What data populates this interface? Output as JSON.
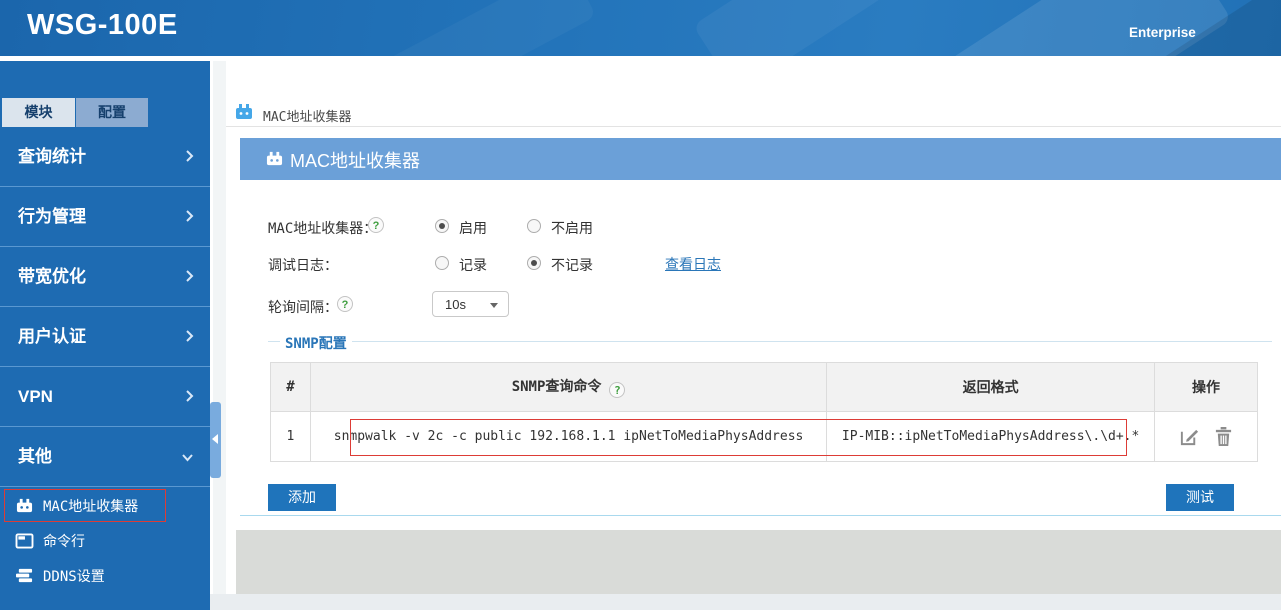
{
  "header": {
    "brand": "WSG-100E",
    "edition_label": "Enterprise"
  },
  "sidebar": {
    "tabs": [
      {
        "label": "模块",
        "active": true
      },
      {
        "label": "配置",
        "active": false
      }
    ],
    "items": [
      {
        "label": "查询统计"
      },
      {
        "label": "行为管理"
      },
      {
        "label": "带宽优化"
      },
      {
        "label": "用户认证"
      },
      {
        "label": "VPN"
      },
      {
        "label": "其他"
      }
    ],
    "subitems": [
      {
        "label": "MAC地址收集器",
        "icon": "collector-icon",
        "highlighted": true
      },
      {
        "label": "命令行",
        "icon": "terminal-icon",
        "highlighted": false
      },
      {
        "label": "DDNS设置",
        "icon": "server-icon",
        "highlighted": false
      }
    ]
  },
  "breadcrumb": {
    "label": "MAC地址收集器"
  },
  "panel": {
    "title": "MAC地址收集器"
  },
  "form": {
    "collector": {
      "label": "MAC地址收集器：",
      "options": [
        {
          "label": "启用",
          "checked": true
        },
        {
          "label": "不启用",
          "checked": false
        }
      ]
    },
    "debug_log": {
      "label": "调试日志：",
      "options": [
        {
          "label": "记录",
          "checked": false
        },
        {
          "label": "不记录",
          "checked": true
        }
      ],
      "link_label": "查看日志"
    },
    "poll_interval": {
      "label": "轮询间隔：",
      "selected": "10s"
    }
  },
  "snmp": {
    "legend": "SNMP配置",
    "table": {
      "headers": {
        "index": "#",
        "command": "SNMP查询命令",
        "format": "返回格式",
        "ops": "操作"
      },
      "rows": [
        {
          "index": "1",
          "command": "snmpwalk -v 2c -c public 192.168.1.1 ipNetToMediaPhysAddress",
          "format": "IP-MIB::ipNetToMediaPhysAddress\\.\\d+.*"
        }
      ]
    },
    "add_label": "添加",
    "test_label": "测试"
  },
  "colors": {
    "header_blue": "#2273b9",
    "sidebar_blue": "#1e6bb2",
    "panel_blue": "#6ba0d8",
    "button_blue": "#1f74bb",
    "link_blue": "#2a76b8",
    "highlight_red": "#dd3c36",
    "help_green": "#3f9e3f"
  }
}
